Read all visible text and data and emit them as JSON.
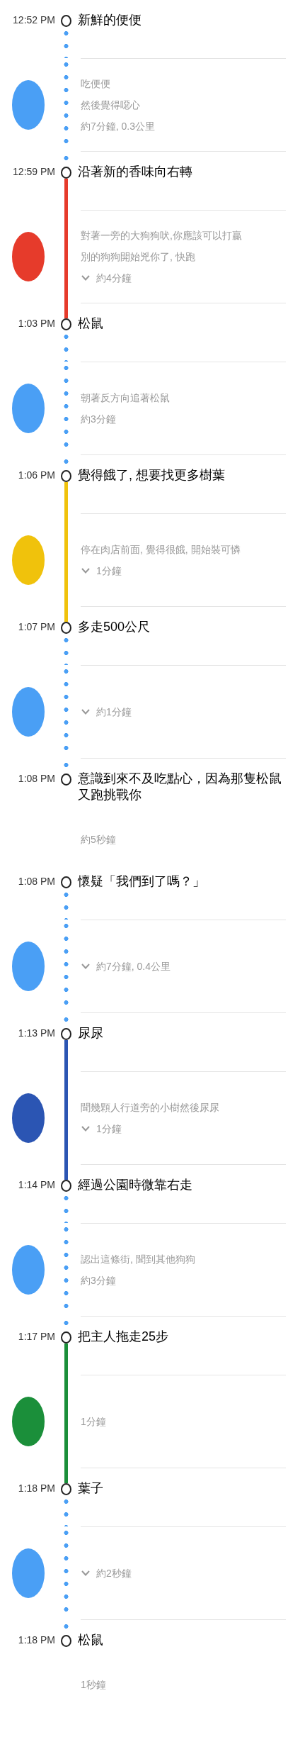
{
  "timeline": [
    {
      "time": "12:52 PM",
      "title": "新鮮的便便",
      "segment": {
        "kind": "dotted",
        "color": "#4a9ff5",
        "lines": [
          "吃便便",
          "然後覺得噁心"
        ],
        "duration": "約7分鐘, 0.3公里",
        "expandable": false
      }
    },
    {
      "time": "12:59 PM",
      "title": "沿著新的香味向右轉",
      "segment": {
        "kind": "solid",
        "color": "#e63b2b",
        "lines": [
          "對著一旁的大狗狗吠,你應該可以打贏",
          "別的狗狗開始兇你了, 快跑"
        ],
        "duration": "約4分鐘",
        "expandable": true
      }
    },
    {
      "time": "1:03 PM",
      "title": "松鼠",
      "segment": {
        "kind": "dotted",
        "color": "#4a9ff5",
        "lines": [
          "朝著反方向追著松鼠"
        ],
        "duration": "約3分鐘",
        "expandable": false
      }
    },
    {
      "time": "1:06 PM",
      "title": "覺得餓了, 想要找更多樹葉",
      "segment": {
        "kind": "solid",
        "color": "#f0c20c",
        "lines": [
          "停在肉店前面, 覺得很餓, 開始裝可憐"
        ],
        "duration": "1分鐘",
        "expandable": true
      }
    },
    {
      "time": "1:07 PM",
      "title": "多走500公尺",
      "segment": {
        "kind": "dotted",
        "color": "#4a9ff5",
        "duration": "約1分鐘",
        "expandable": true
      }
    },
    {
      "time": "1:08 PM",
      "title": "意識到來不及吃點心，因為那隻松鼠又跑挑戰你",
      "segment": {
        "kind": "none",
        "duration": "約5秒鐘",
        "expandable": false
      }
    },
    {
      "time": "1:08 PM",
      "title": "懷疑「我們到了嗎？」",
      "segment": {
        "kind": "dotted",
        "color": "#4a9ff5",
        "duration": "約7分鐘, 0.4公里",
        "expandable": true
      }
    },
    {
      "time": "1:13 PM",
      "title": "尿尿",
      "segment": {
        "kind": "solid",
        "color": "#2b55b3",
        "lines": [
          "聞幾顆人行道旁的小樹然後尿尿"
        ],
        "duration": "1分鐘",
        "expandable": true
      }
    },
    {
      "time": "1:14 PM",
      "title": "經過公園時微靠右走",
      "segment": {
        "kind": "dotted",
        "color": "#4a9ff5",
        "lines": [
          "認出這條街, 聞到其他狗狗"
        ],
        "duration": "約3分鐘",
        "expandable": false
      }
    },
    {
      "time": "1:17 PM",
      "title": "把主人拖走25步",
      "segment": {
        "kind": "solid",
        "color": "#1b8f3a",
        "duration": "1分鐘",
        "expandable": false
      }
    },
    {
      "time": "1:18 PM",
      "title": "葉子",
      "segment": {
        "kind": "dotted",
        "color": "#4a9ff5",
        "duration": "約2秒鐘",
        "expandable": true
      }
    },
    {
      "time": "1:18 PM",
      "title": "松鼠",
      "segment": {
        "kind": "none",
        "duration": "1秒鐘",
        "expandable": false
      }
    }
  ]
}
